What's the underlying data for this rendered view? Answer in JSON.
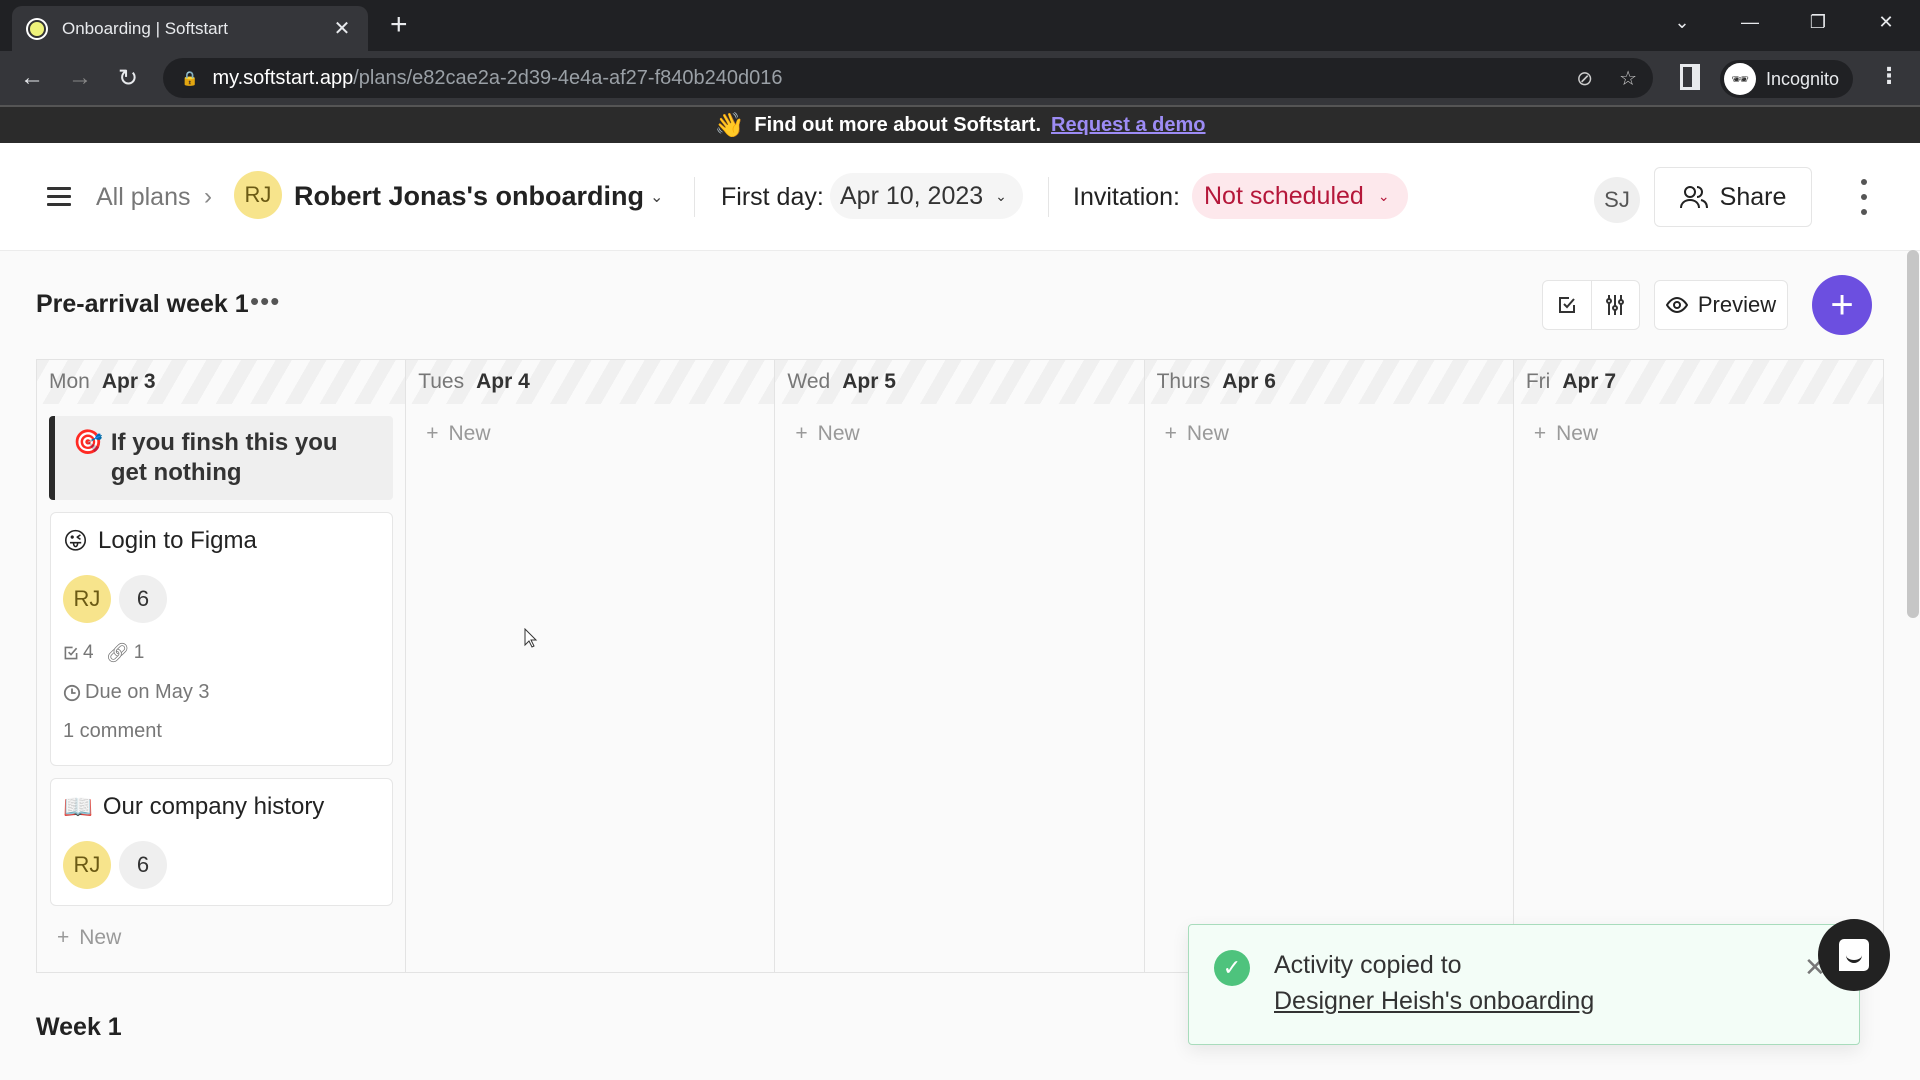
{
  "browser": {
    "tab_title": "Onboarding | Softstart",
    "url_host": "my.softstart.app",
    "url_path": "/plans/e82cae2a-2d39-4e4a-af27-f840b240d016",
    "profile_label": "Incognito"
  },
  "promo": {
    "emoji": "👋",
    "text": "Find out more about Softstart.",
    "link": "Request a demo",
    "link_color": "#9d8cf5"
  },
  "header": {
    "breadcrumb_root": "All plans",
    "plan_initials": "RJ",
    "plan_title": "Robert Jonas's onboarding",
    "first_day_label": "First day:",
    "first_day_value": "Apr 10, 2023",
    "invitation_label": "Invitation:",
    "invitation_value": "Not scheduled",
    "invitation_color": "#b5173a",
    "user_initials": "SJ",
    "share_label": "Share"
  },
  "section": {
    "title": "Pre-arrival week 1",
    "preview_label": "Preview",
    "accent_color": "#6c4fe0",
    "new_label": "New",
    "columns": [
      {
        "day": "Mon",
        "date": "Apr 3"
      },
      {
        "day": "Tues",
        "date": "Apr 4"
      },
      {
        "day": "Wed",
        "date": "Apr 5"
      },
      {
        "day": "Thurs",
        "date": "Apr 6"
      },
      {
        "day": "Fri",
        "date": "Apr 7"
      }
    ],
    "milestone": {
      "emoji": "🎯",
      "text": "If you finsh this you get nothing"
    },
    "cards": [
      {
        "emoji": "😜",
        "title": "Login to Figma",
        "assignee": "RJ",
        "count": "6",
        "tasks": "4",
        "links": "1",
        "due": "Due on May 3",
        "comments": "1 comment"
      },
      {
        "emoji": "📖",
        "title": "Our company history",
        "assignee": "RJ",
        "count": "6"
      }
    ]
  },
  "next_section": {
    "title": "Week 1"
  },
  "toast": {
    "message": "Activity copied to",
    "link": "Designer Heish's onboarding",
    "status_color": "#4ec37d"
  }
}
